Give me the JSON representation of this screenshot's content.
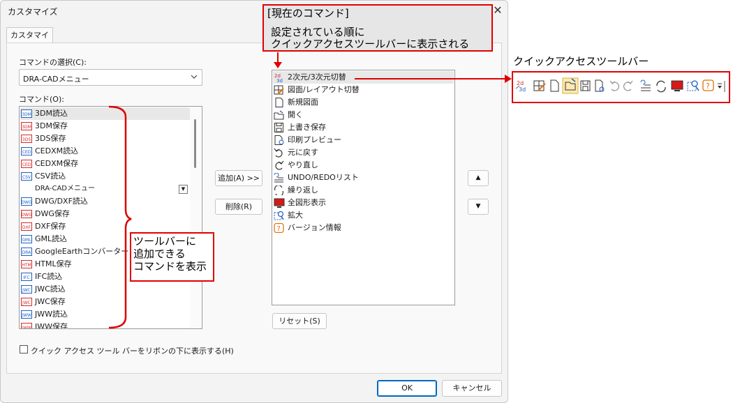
{
  "dialog": {
    "title": "カスタマイズ",
    "close_glyph": "✕",
    "tab_label": "カスタマイズ",
    "command_select_label": "コマンドの選択(C):",
    "command_select_value": "DRA-CADメニュー",
    "commands_label": "コマンド(O):",
    "add_button": "追加(A) >>",
    "remove_button": "削除(R)",
    "reset_button": "リセット(S)",
    "ok_button": "OK",
    "cancel_button": "キャンセル",
    "ribbon_checkbox_label": "クイック アクセス ツール バーをリボンの下に表示する(H)",
    "ribbon_checkbox_checked": false,
    "move_up_glyph": "▲",
    "move_down_glyph": "▼"
  },
  "command_list": [
    {
      "label": "3DM読込",
      "icon": "3dm-read-icon",
      "badge": "3DM",
      "color": "#1f5fbf",
      "selected": true
    },
    {
      "label": "3DM保存",
      "icon": "3dm-save-icon",
      "badge": "3DM",
      "color": "#d42a2a"
    },
    {
      "label": "3DS保存",
      "icon": "3ds-save-icon",
      "badge": "3DS",
      "color": "#d42a2a"
    },
    {
      "label": "CEDXM読込",
      "icon": "cedxm-read-icon",
      "badge": "CED",
      "color": "#1f5fbf"
    },
    {
      "label": "CEDXM保存",
      "icon": "cedxm-save-icon",
      "badge": "CED",
      "color": "#d42a2a"
    },
    {
      "label": "CSV読込",
      "icon": "csv-read-icon",
      "badge": "CSV",
      "color": "#1f5fbf"
    },
    {
      "label": "DRA-CADメニュー",
      "icon": "",
      "badge": "",
      "color": "",
      "submenu": true
    },
    {
      "label": "DWG/DXF読込",
      "icon": "dwg-dxf-read-icon",
      "badge": "DWG",
      "color": "#1f5fbf"
    },
    {
      "label": "DWG保存",
      "icon": "dwg-save-icon",
      "badge": "DWG",
      "color": "#d42a2a"
    },
    {
      "label": "DXF保存",
      "icon": "dxf-save-icon",
      "badge": "DXF",
      "color": "#d42a2a"
    },
    {
      "label": "GML読込",
      "icon": "gml-read-icon",
      "badge": "GML",
      "color": "#1f5fbf"
    },
    {
      "label": "GoogleEarthコンバーター",
      "icon": "google-earth-icon",
      "badge": "DRA",
      "color": "#1f5fbf"
    },
    {
      "label": "HTML保存",
      "icon": "html-save-icon",
      "badge": "HTM",
      "color": "#d42a2a"
    },
    {
      "label": "IFC読込",
      "icon": "ifc-read-icon",
      "badge": "IFC",
      "color": "#1f5fbf"
    },
    {
      "label": "JWC読込",
      "icon": "jwc-read-icon",
      "badge": "JWC",
      "color": "#1f5fbf"
    },
    {
      "label": "JWC保存",
      "icon": "jwc-save-icon",
      "badge": "JWC",
      "color": "#d42a2a"
    },
    {
      "label": "JWW読込",
      "icon": "jww-read-icon",
      "badge": "JWW",
      "color": "#1f5fbf"
    },
    {
      "label": "JWW保存",
      "icon": "jww-save-icon",
      "badge": "JWW",
      "color": "#d42a2a"
    }
  ],
  "current_list": [
    {
      "label": "2次元/3次元切替",
      "icon": "2d-3d-toggle-icon",
      "selected": true
    },
    {
      "label": "図面/レイアウト切替",
      "icon": "drawing-layout-toggle-icon"
    },
    {
      "label": "新規図面",
      "icon": "new-drawing-icon"
    },
    {
      "label": "開く",
      "icon": "open-folder-icon"
    },
    {
      "label": "上書き保存",
      "icon": "save-icon"
    },
    {
      "label": "印刷プレビュー",
      "icon": "print-preview-icon"
    },
    {
      "label": "元に戻す",
      "icon": "undo-icon"
    },
    {
      "label": "やり直し",
      "icon": "redo-icon"
    },
    {
      "label": "UNDO/REDOリスト",
      "icon": "undo-redo-list-icon"
    },
    {
      "label": "繰り返し",
      "icon": "repeat-icon"
    },
    {
      "label": "全図形表示",
      "icon": "show-all-icon"
    },
    {
      "label": "拡大",
      "icon": "zoom-in-icon"
    },
    {
      "label": "バージョン情報",
      "icon": "version-info-icon"
    }
  ],
  "annotations": {
    "current_title": "[現在のコマンド]",
    "current_desc_1": "設定されている順に",
    "current_desc_2": "クイックアクセスツールバーに表示される",
    "list_note_1": "ツールバーに",
    "list_note_2": "追加できる",
    "list_note_3": "コマンドを表示",
    "toolbar_title": "クイックアクセスツールバー"
  },
  "colors": {
    "annotation_red": "#e00000",
    "accent_blue": "#0067c0"
  }
}
